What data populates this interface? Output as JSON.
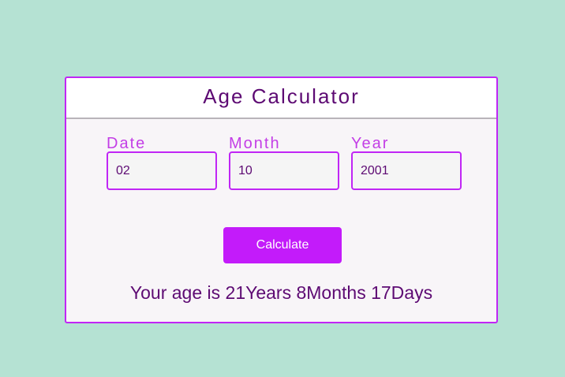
{
  "app": {
    "title": "Age Calculator"
  },
  "form": {
    "date": {
      "label": "Date",
      "value": "02"
    },
    "month": {
      "label": "Month",
      "value": "10"
    },
    "year": {
      "label": "Year",
      "value": "2001"
    }
  },
  "button": {
    "label": "Calculate"
  },
  "result": {
    "text": "Your age is 21Years 8Months 17Days"
  },
  "colors": {
    "background": "#b5e2d3",
    "accent": "#c026f5",
    "button": "#c31bfa",
    "title_text": "#5d0a73",
    "label_text": "#c33ee6"
  }
}
